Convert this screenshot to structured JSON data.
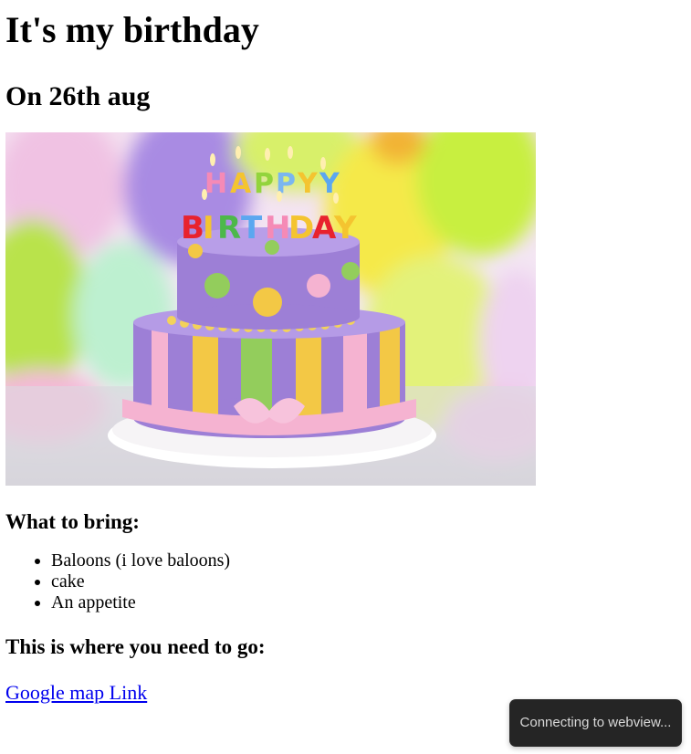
{
  "page": {
    "title": "It's my birthday",
    "subtitle": "On 26th aug"
  },
  "hero_image": {
    "alt": "Birthday cake",
    "candle_letters": "HAPPY BIRTHDAY",
    "colors": {
      "balloon_purple": "#a98be3",
      "balloon_lime": "#c8ef3f",
      "balloon_yellow": "#f5e94a",
      "cake_purple": "#9d7fd6",
      "ribbon_pink": "#f5b3d1",
      "stripe_yellow": "#f3c845",
      "stripe_green": "#93cd5c"
    }
  },
  "bring_section": {
    "heading": "What to bring:",
    "items": [
      "Baloons (i love baloons)",
      "cake",
      "An appetite"
    ]
  },
  "location_section": {
    "heading": "This is where you need to go:",
    "link_text": "Google map Link"
  },
  "toast": {
    "text": "Connecting to webview..."
  }
}
